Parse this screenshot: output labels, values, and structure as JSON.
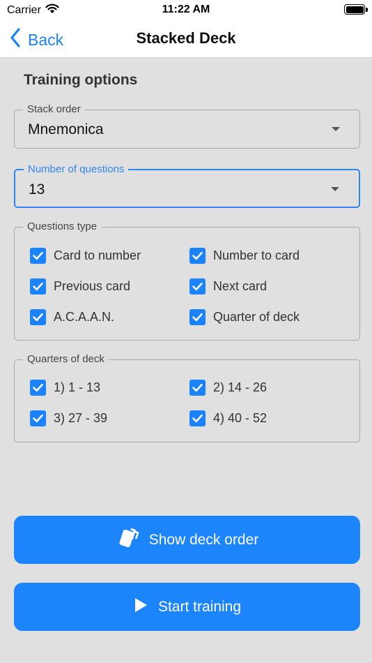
{
  "status_bar": {
    "carrier": "Carrier",
    "time": "11:22 AM"
  },
  "navbar": {
    "back_label": "Back",
    "title": "Stacked Deck"
  },
  "section_title": "Training options",
  "stack_order": {
    "label": "Stack order",
    "value": "Mnemonica"
  },
  "number_of_questions": {
    "label": "Number of questions",
    "value": "13"
  },
  "questions_type": {
    "label": "Questions type",
    "items": [
      {
        "label": "Card to number",
        "checked": true
      },
      {
        "label": "Number to card",
        "checked": true
      },
      {
        "label": "Previous card",
        "checked": true
      },
      {
        "label": "Next card",
        "checked": true
      },
      {
        "label": "A.C.A.A.N.",
        "checked": true
      },
      {
        "label": "Quarter of deck",
        "checked": true
      }
    ]
  },
  "quarters_of_deck": {
    "label": "Quarters of deck",
    "items": [
      {
        "label": "1) 1 - 13",
        "checked": true
      },
      {
        "label": "2) 14 - 26",
        "checked": true
      },
      {
        "label": "3) 27 - 39",
        "checked": true
      },
      {
        "label": "4) 40 - 52",
        "checked": true
      }
    ]
  },
  "buttons": {
    "show_deck_order": "Show deck order",
    "start_training": "Start training"
  },
  "colors": {
    "accent": "#1d85fc",
    "focus": "#2f86ef",
    "background": "#e0e0e0"
  }
}
